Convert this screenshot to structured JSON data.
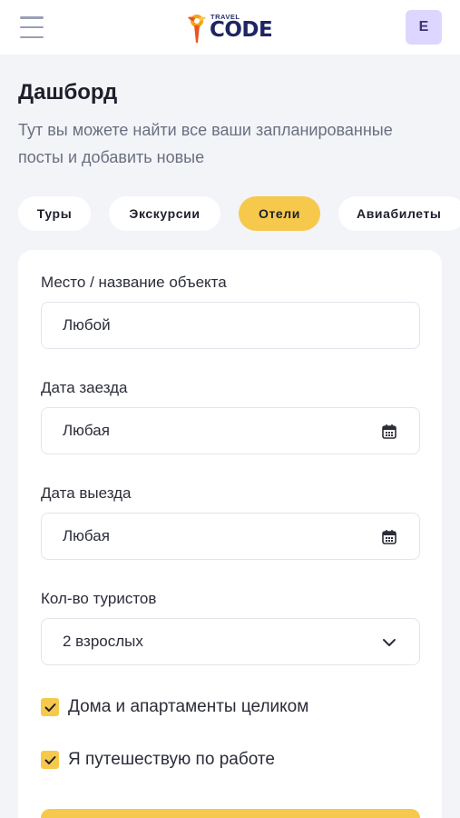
{
  "header": {
    "logo_small": "TRAVEL",
    "logo_big": "CODE",
    "avatar_letter": "E"
  },
  "page": {
    "title": "Дашборд",
    "subtitle": "Тут вы можете найти все ваши запланированные посты и добавить новые"
  },
  "tabs": [
    {
      "label": "Туры",
      "active": false
    },
    {
      "label": "Экскурсии",
      "active": false
    },
    {
      "label": "Отели",
      "active": true
    },
    {
      "label": "Авиабилеты",
      "active": false
    }
  ],
  "form": {
    "place": {
      "label": "Место / название объекта",
      "value": "Любой"
    },
    "checkin": {
      "label": "Дата заезда",
      "value": "Любая",
      "icon": "calendar-icon"
    },
    "checkout": {
      "label": "Дата выезда",
      "value": "Любая",
      "icon": "calendar-icon"
    },
    "tourists": {
      "label": "Кол-во туристов",
      "value": "2 взрослых",
      "icon": "chevron-down-icon"
    },
    "checkboxes": [
      {
        "label": "Дома и апартаменты целиком",
        "checked": true
      },
      {
        "label": "Я путешествую по работе",
        "checked": true
      }
    ]
  },
  "colors": {
    "accent": "#f6c94c",
    "background": "#f3f4f8",
    "avatar_bg": "#ddd6fe",
    "logo_text": "#1f2563"
  }
}
